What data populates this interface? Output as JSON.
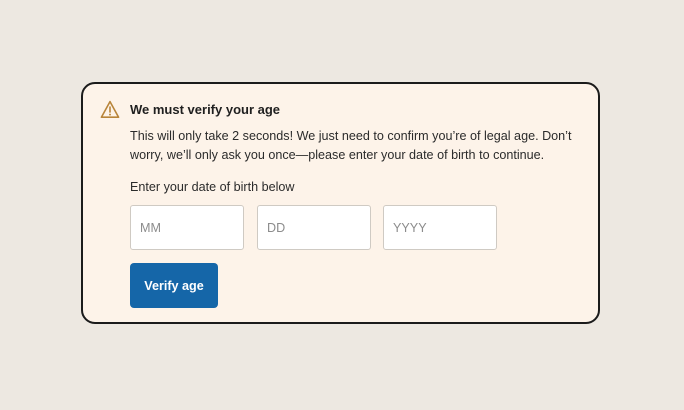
{
  "dialog": {
    "icon": "warning-triangle-icon",
    "title": "We must verify your age",
    "description": "This will only take 2 seconds! We just need to confirm you’re of legal age. Don’t worry, we’ll only ask you once—please enter your date of birth to continue.",
    "prompt": "Enter your date of birth below",
    "inputs": {
      "month": {
        "value": "",
        "placeholder": "MM"
      },
      "day": {
        "value": "",
        "placeholder": "DD"
      },
      "year": {
        "value": "",
        "placeholder": "YYYY"
      }
    },
    "button_label": "Verify age"
  },
  "colors": {
    "background": "#ede8e1",
    "card": "#fdf3e9",
    "card_border": "#1b1b1b",
    "warning_icon": "#b8843a",
    "button": "#1566a8"
  }
}
